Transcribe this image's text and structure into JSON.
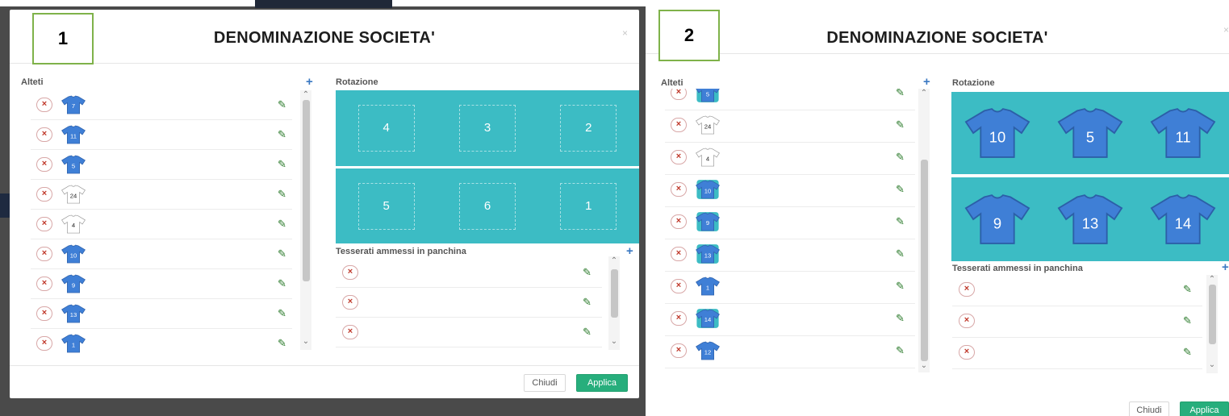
{
  "panels": [
    {
      "label_number": "1",
      "title": "DENOMINAZIONE SOCIETA'",
      "close_symbol": "×",
      "athletes_label": "Alteti",
      "add_symbol": "+",
      "rotation_label": "Rotazione",
      "bench_label": "Tesserati ammessi in panchina",
      "athletes": [
        {
          "number": "7",
          "style": "blue"
        },
        {
          "number": "11",
          "style": "blue"
        },
        {
          "number": "5",
          "style": "blue"
        },
        {
          "number": "24",
          "style": "white"
        },
        {
          "number": "4",
          "style": "white"
        },
        {
          "number": "10",
          "style": "blue"
        },
        {
          "number": "9",
          "style": "blue"
        },
        {
          "number": "13",
          "style": "blue"
        },
        {
          "number": "1",
          "style": "blue"
        }
      ],
      "rotation": {
        "front": [
          "4",
          "3",
          "2"
        ],
        "back": [
          "5",
          "6",
          "1"
        ],
        "mode": "empty"
      },
      "bench_count": 3,
      "buttons": {
        "close": "Chiudi",
        "apply": "Applica"
      },
      "remove_symbol": "×",
      "edit_symbol": "✎",
      "scroll_up": "⌃",
      "scroll_down": "⌄"
    },
    {
      "label_number": "2",
      "title": "DENOMINAZIONE SOCIETA'",
      "close_symbol": "×",
      "athletes_label": "Alteti",
      "add_symbol": "+",
      "rotation_label": "Rotazione",
      "bench_label": "Tesserati ammessi in panchina",
      "athletes": [
        {
          "number": "5",
          "style": "teal"
        },
        {
          "number": "24",
          "style": "white"
        },
        {
          "number": "4",
          "style": "white"
        },
        {
          "number": "10",
          "style": "teal"
        },
        {
          "number": "9",
          "style": "teal"
        },
        {
          "number": "13",
          "style": "teal"
        },
        {
          "number": "1",
          "style": "blue"
        },
        {
          "number": "14",
          "style": "teal"
        },
        {
          "number": "12",
          "style": "blue"
        }
      ],
      "rotation": {
        "front": [
          "10",
          "5",
          "11"
        ],
        "back": [
          "9",
          "13",
          "14"
        ],
        "mode": "filled"
      },
      "bench_count": 3,
      "buttons": {
        "close": "Chiudi",
        "apply": "Applica"
      },
      "remove_symbol": "×",
      "edit_symbol": "✎",
      "scroll_up": "⌃",
      "scroll_down": "⌄"
    }
  ],
  "colors": {
    "court": "#3cbcc4",
    "shirt_blue": "#3f7fd6",
    "apply_button": "#27ae7c",
    "label_box_border": "#7fb24a"
  },
  "icons": {
    "remove": "remove-circle-icon",
    "edit": "pencil-icon",
    "shirt": "jersey-icon",
    "add": "plus-icon",
    "close": "close-icon"
  }
}
